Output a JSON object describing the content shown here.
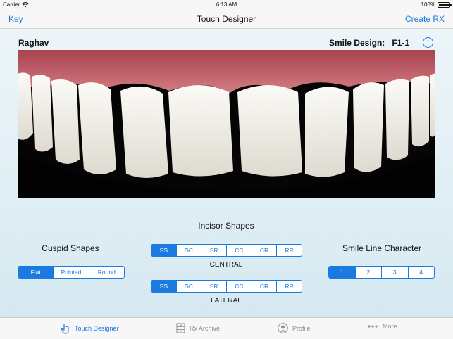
{
  "status_bar": {
    "carrier": "Carrier",
    "time": "6:13 AM",
    "battery": "100%"
  },
  "nav": {
    "left_label": "Key",
    "title": "Touch Designer",
    "right_label": "Create RX"
  },
  "patient": {
    "name": "Raghav"
  },
  "smile_design": {
    "label": "Smile Design:",
    "value": "F1-1"
  },
  "incisor": {
    "title": "Incisor Shapes",
    "central_label": "CENTRAL",
    "lateral_label": "LATERAL",
    "central_options": [
      "SS",
      "SC",
      "SR",
      "CC",
      "CR",
      "RR"
    ],
    "central_selected": "SS",
    "lateral_options": [
      "SS",
      "SC",
      "SR",
      "CC",
      "CR",
      "RR"
    ],
    "lateral_selected": "SS"
  },
  "cuspid": {
    "title": "Cuspid Shapes",
    "options": [
      "Flat",
      "Pointed",
      "Round"
    ],
    "selected": "Flat"
  },
  "smile_line": {
    "title": "Smile Line Character",
    "options": [
      "1",
      "2",
      "3",
      "4"
    ],
    "selected": "1"
  },
  "tabs": [
    {
      "label": "Touch Designer",
      "icon": "hand-pointer-icon",
      "active": true
    },
    {
      "label": "Rx Archive",
      "icon": "archive-icon",
      "active": false
    },
    {
      "label": "Profile",
      "icon": "profile-icon",
      "active": false
    },
    {
      "label": "More",
      "icon": "more-icon",
      "active": false
    }
  ],
  "colors": {
    "accent": "#1a7ae0",
    "background": "#e6f2f6",
    "gum": "#c96a72",
    "tooth": "#f3f1ea"
  }
}
